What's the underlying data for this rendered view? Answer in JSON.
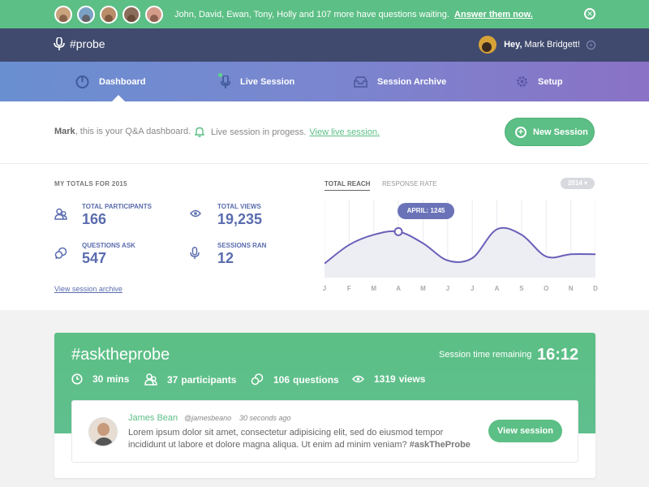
{
  "notification": {
    "text": "John, David, Ewan, Tony, Holly and 107 more have questions waiting.",
    "link": "Answer them now."
  },
  "header": {
    "app_name": "#probe",
    "greeting": "Hey,",
    "user_name": "Mark Bridgett!"
  },
  "nav": {
    "items": [
      {
        "label": "Dashboard",
        "icon": "gauge-icon"
      },
      {
        "label": "Live Session",
        "icon": "mic-icon"
      },
      {
        "label": "Session Archive",
        "icon": "inbox-icon"
      },
      {
        "label": "Setup",
        "icon": "gear-icon"
      }
    ],
    "active": "Dashboard"
  },
  "welcome": {
    "name": "Mark",
    "text": ", this is your Q&A dashboard.",
    "live_text": "Live session in progess.",
    "live_link": "View live session.",
    "new_session": "New Session"
  },
  "totals": {
    "title": "MY TOTALS FOR 2015",
    "stats": [
      {
        "label": "TOTAL PARTICIPANTS",
        "value": "166",
        "icon": "participants-icon"
      },
      {
        "label": "TOTAL VIEWS",
        "value": "19,235",
        "icon": "eye-icon"
      },
      {
        "label": "QUESTIONS ASK",
        "value": "547",
        "icon": "questions-icon"
      },
      {
        "label": "SESSIONS RAN",
        "value": "12",
        "icon": "mic-icon"
      }
    ],
    "archive_link": "View session archive"
  },
  "chart": {
    "tab_active": "TOTAL REACH",
    "tab_inactive": "RESPONSE RATE",
    "year": "2014",
    "tooltip": "APRIL: 1245"
  },
  "chart_data": {
    "type": "area",
    "categories": [
      "J",
      "F",
      "M",
      "A",
      "M",
      "J",
      "J",
      "A",
      "S",
      "O",
      "N",
      "D"
    ],
    "values": [
      0.18,
      0.42,
      0.55,
      0.59,
      0.44,
      0.22,
      0.25,
      0.62,
      0.55,
      0.27,
      0.3,
      0.3
    ],
    "highlight": {
      "category_index": 3,
      "label": "APRIL: 1245"
    },
    "title": "",
    "xlabel": "",
    "ylabel": ""
  },
  "session": {
    "hashtag": "#asktheprobe",
    "time_label": "Session time remaining",
    "time_value": "16:12",
    "duration_num": "30",
    "duration_unit": "mins",
    "participants_num": "37",
    "participants_unit": "participants",
    "questions_num": "106",
    "questions_unit": "questions",
    "views_num": "1319",
    "views_unit": "views"
  },
  "question": {
    "name": "James Bean",
    "handle": "@jamesbeano",
    "time": "30 seconds ago",
    "body": "Lorem ipsum dolor sit amet, consectetur adipisicing elit, sed do eiusmod tempor incididunt ut labore et dolore magna aliqua. Ut enim ad minim veniam?",
    "tag": "#askTheProbe",
    "button": "View session"
  }
}
